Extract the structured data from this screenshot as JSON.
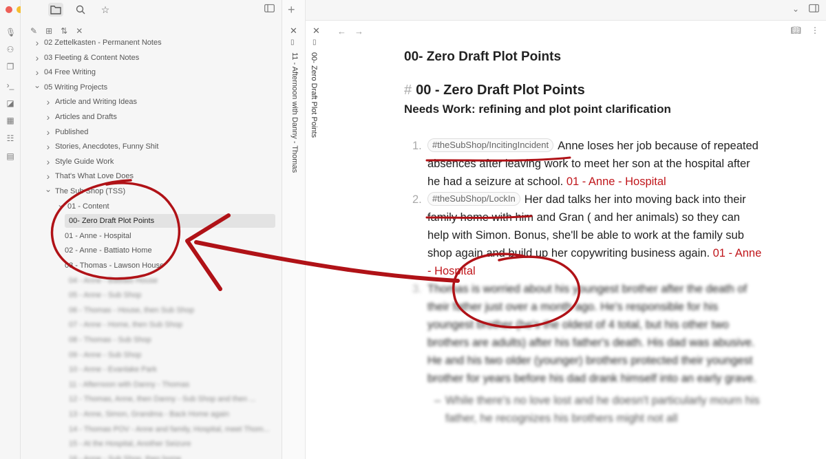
{
  "colors": {
    "traffic_red": "#ed5f57",
    "traffic_yellow": "#f5bd2f",
    "traffic_green": "#2ec642",
    "annotation_red": "#b01217",
    "link_red": "#c0161b"
  },
  "sidebar": {
    "tree": [
      {
        "label": "02 Zettelkasten - Permanent Notes",
        "indent": 1,
        "chevron": "right"
      },
      {
        "label": "03 Fleeting & Content Notes",
        "indent": 1,
        "chevron": "right"
      },
      {
        "label": "04 Free Writing",
        "indent": 1,
        "chevron": "right"
      },
      {
        "label": "05 Writing Projects",
        "indent": 1,
        "chevron": "down"
      },
      {
        "label": "Article and Writing Ideas",
        "indent": 2,
        "chevron": "right"
      },
      {
        "label": "Articles and Drafts",
        "indent": 2,
        "chevron": "right"
      },
      {
        "label": "Published",
        "indent": 2,
        "chevron": "right"
      },
      {
        "label": "Stories, Anecdotes, Funny Shit",
        "indent": 2,
        "chevron": "right"
      },
      {
        "label": "Style Guide Work",
        "indent": 2,
        "chevron": "right"
      },
      {
        "label": "That's What Love Does",
        "indent": 2,
        "chevron": "right"
      },
      {
        "label": "The Sub Shop (TSS)",
        "indent": 2,
        "chevron": "down"
      },
      {
        "label": "01 - Content",
        "indent": 3,
        "chevron": "down"
      },
      {
        "label": "00- Zero Draft Plot Points",
        "indent": 4,
        "chevron": "",
        "active": true
      },
      {
        "label": "01 - Anne - Hospital",
        "indent": 4,
        "chevron": ""
      },
      {
        "label": "02 - Anne - Battiato Home",
        "indent": 4,
        "chevron": ""
      },
      {
        "label": "03 - Thomas - Lawson House",
        "indent": 4,
        "chevron": ""
      }
    ],
    "blurred_items": [
      "04 - Anne - Battiato House",
      "05 - Anne - Sub Shop",
      "06 - Thomas - House, then Sub Shop",
      "07 - Anne - Home, then Sub Shop",
      "08 - Thomas - Sub Shop",
      "09 - Anne - Sub Shop",
      "10 - Anne - Evanlake Park",
      "11 - Afternoon with Danny - Thomas",
      "12 - Thomas, Anne, then Danny - Sub Shop and then ...",
      "13 - Anne, Simon, Grandma - Back Home again",
      "14 - Thomas POV - Anne and family, Hospital, meet Thom...",
      "15 - At the Hospital, Another Seizure",
      "16 - Anne - Sub Shop, then home"
    ]
  },
  "stacked_tabs": {
    "tab1": "11 - Afternoon with Danny - Thomas",
    "tab2": "00- Zero Draft Plot Points"
  },
  "doc": {
    "inline_title": "00- Zero Draft Plot Points",
    "h1_hash": "#",
    "h1": "00 - Zero Draft Plot Points",
    "h2": "Needs Work: refining and plot point clarification",
    "points": [
      {
        "num": "1.",
        "tag": "#theSubShop/IncitingIncident",
        "text": "Anne loses her job because of repeated absences after leaving work to meet her son at the hospital after he had a seizure at school.",
        "link": "01 - Anne - Hospital"
      },
      {
        "num": "2.",
        "tag": "#theSubShop/LockIn",
        "text": "Her dad talks her into moving back into their family home with him and Gran ( and her animals) so they can help with Simon. Bonus, she'll be able to work at the family sub shop again and build up her copywriting business again.",
        "link": "01 - Anne - Hospital"
      },
      {
        "num": "3.",
        "text": "Thomas is worried about his youngest brother after the death of their father just over a month ago. He's responsible for his youngest brother (he's the oldest of 4 total, but his other two brothers are adults) after his father's death. His dad was abusive. He and his two older (younger) brothers protected their youngest brother for years before his dad drank himself into an early grave."
      }
    ],
    "sub_point": "While there's no love lost and he doesn't particularly mourn his father, he recognizes his brothers might not all"
  }
}
